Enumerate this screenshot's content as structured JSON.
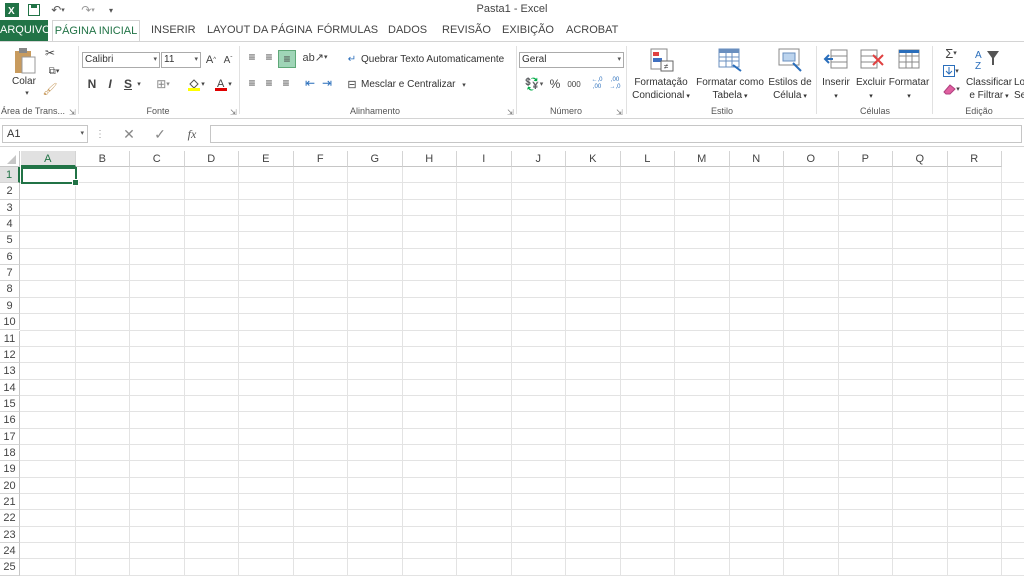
{
  "window": {
    "title": "Pasta1 - Excel"
  },
  "tabs": {
    "file": "ARQUIVO",
    "home": "PÁGINA INICIAL",
    "insert": "INSERIR",
    "layout": "LAYOUT DA PÁGINA",
    "formulas": "FÓRMULAS",
    "data": "DADOS",
    "review": "REVISÃO",
    "view": "EXIBIÇÃO",
    "acrobat": "ACROBAT"
  },
  "ribbon": {
    "clipboard": {
      "paste": "Colar",
      "label": "Área de Trans..."
    },
    "font": {
      "name": "Calibri",
      "size": "11",
      "bold": "N",
      "italic": "I",
      "underline": "S",
      "label": "Fonte"
    },
    "alignment": {
      "wrap": "Quebrar Texto Automaticamente",
      "merge": "Mesclar e Centralizar",
      "label": "Alinhamento"
    },
    "number": {
      "format": "Geral",
      "percent": "%",
      "thousands": "000",
      "inc_decimal": "←,0 ,00",
      "dec_decimal": ",00 →,0",
      "label": "Número"
    },
    "styles": {
      "conditional_l1": "Formatação",
      "conditional_l2": "Condicional",
      "table_l1": "Formatar como",
      "table_l2": "Tabela",
      "cell_l1": "Estilos de",
      "cell_l2": "Célula",
      "label": "Estilo"
    },
    "cells": {
      "insert": "Inserir",
      "delete": "Excluir",
      "format": "Formatar",
      "label": "Células"
    },
    "editing": {
      "sort_l1": "Classificar",
      "sort_l2": "e Filtrar",
      "find_l1": "Lo",
      "find_l2": "Se",
      "sum": "Σ",
      "label": "Edição"
    }
  },
  "formula_bar": {
    "name_box": "A1",
    "fx": "fx",
    "value": ""
  },
  "grid": {
    "columns": [
      "A",
      "B",
      "C",
      "D",
      "E",
      "F",
      "G",
      "H",
      "I",
      "J",
      "K",
      "L",
      "M",
      "N",
      "O",
      "P",
      "Q",
      "R"
    ],
    "rows": [
      "1",
      "2",
      "3",
      "4",
      "5",
      "6",
      "7",
      "8",
      "9",
      "10",
      "11",
      "12",
      "13",
      "14",
      "15",
      "16",
      "17",
      "18",
      "19",
      "20",
      "21",
      "22",
      "23",
      "24",
      "25"
    ],
    "selected": "A1"
  },
  "colors": {
    "accent": "#217346",
    "header_sel": "#e1e1e1",
    "gridline": "#e3e3e3"
  }
}
